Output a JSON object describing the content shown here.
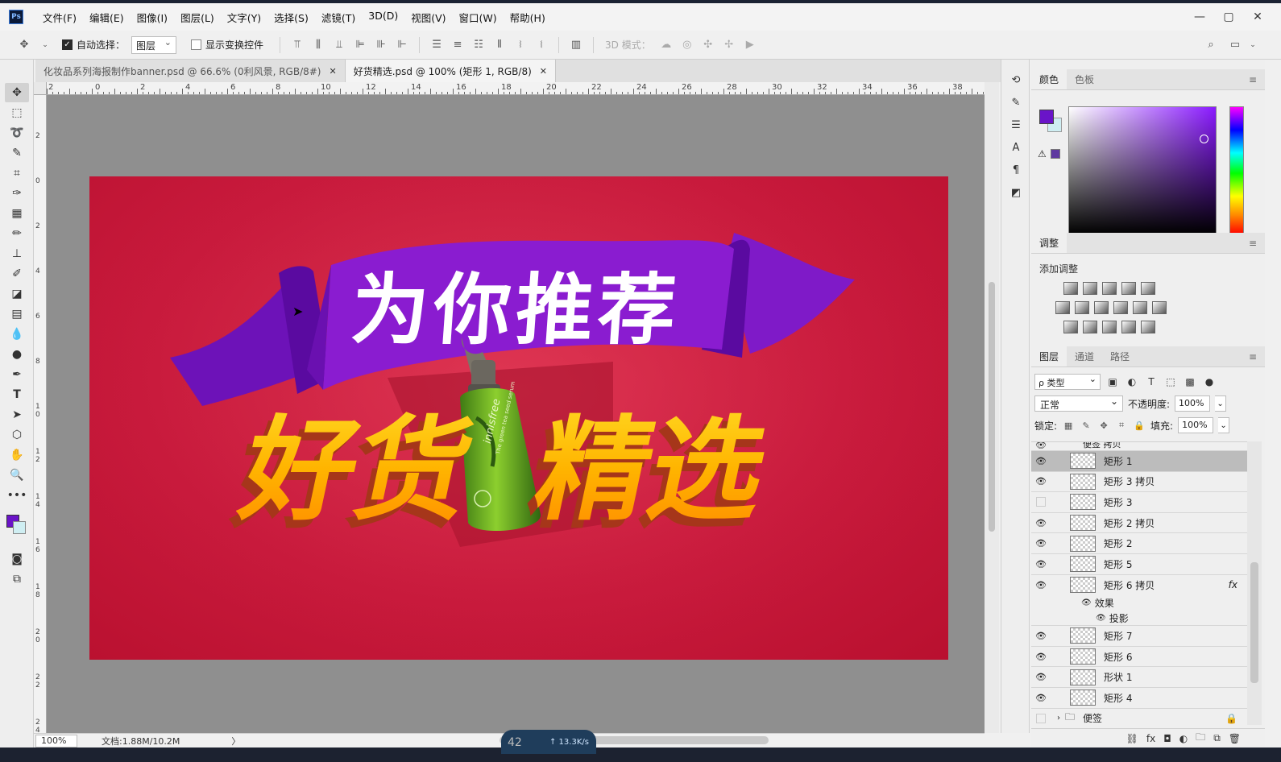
{
  "app": {
    "logo": "Ps"
  },
  "menu": [
    "文件(F)",
    "编辑(E)",
    "图像(I)",
    "图层(L)",
    "文字(Y)",
    "选择(S)",
    "滤镜(T)",
    "3D(D)",
    "视图(V)",
    "窗口(W)",
    "帮助(H)"
  ],
  "window_controls": {
    "minimize": "—",
    "restore": "▢",
    "close": "✕"
  },
  "options": {
    "auto_select_label": "自动选择：",
    "auto_select_target": "图层",
    "show_transform_label": "显示变换控件",
    "mode_3d_label": "3D 模式："
  },
  "tabs": [
    {
      "label": "化妆品系列海报制作banner.psd @ 66.6% (0利风景, RGB/8#)",
      "close": "✕"
    },
    {
      "label": "好货精选.psd @ 100% (矩形 1, RGB/8)",
      "close": "✕"
    }
  ],
  "ruler_h": [
    "2",
    "0",
    "2",
    "4",
    "6",
    "8",
    "10",
    "12",
    "14",
    "16",
    "18",
    "20",
    "22",
    "24",
    "26",
    "28",
    "30",
    "32",
    "34",
    "36",
    "38"
  ],
  "ruler_v": [
    "2",
    "0",
    "2",
    "4",
    "6",
    "8",
    "1 0",
    "1 2",
    "1 4",
    "1 6",
    "1 8",
    "2 0",
    "2 2",
    "2 4"
  ],
  "artwork": {
    "headline": "为你推荐",
    "sub_left": "好货",
    "sub_right": "精选",
    "bottle_brand": "innisfree",
    "bottle_text": "The green tea seed serum",
    "colors": {
      "background": "#c81a3c",
      "ribbon": "#7a1ac2",
      "gold": "#ffb400"
    }
  },
  "status": {
    "zoom": "100%",
    "doc_info": "文档:1.88M/10.2M",
    "arrow": "〉",
    "net_speed": "↑ 13.3K/s",
    "net_num": "42"
  },
  "color_panel": {
    "tabs": [
      "颜色",
      "色板"
    ],
    "fg": "#6a14c8",
    "bg": "#cfeef2"
  },
  "adjust_panel": {
    "tab": "调整",
    "title": "添加调整"
  },
  "layers_panel": {
    "tabs": [
      "图层",
      "通道",
      "路径"
    ],
    "kind": "ρ 类型",
    "blend": "正常",
    "opacity_label": "不透明度:",
    "opacity": "100%",
    "lock_label": "锁定:",
    "fill_label": "填充:",
    "fill": "100%",
    "group_top": "便签 拷贝",
    "layers": [
      {
        "name": "矩形 1",
        "visible": true,
        "selected": true
      },
      {
        "name": "矩形 3 拷贝",
        "visible": true
      },
      {
        "name": "矩形 3",
        "visible": false
      },
      {
        "name": "矩形 2 拷贝",
        "visible": true
      },
      {
        "name": "矩形 2",
        "visible": true
      },
      {
        "name": "矩形 5",
        "visible": true
      },
      {
        "name": "矩形 6 拷贝",
        "visible": true,
        "fx": "fx"
      },
      {
        "name": "矩形 7",
        "visible": true
      },
      {
        "name": "矩形 6",
        "visible": true
      },
      {
        "name": "形状 1",
        "visible": true
      },
      {
        "name": "矩形 4",
        "visible": true
      }
    ],
    "effects_label": "效果",
    "effect_item": "投影",
    "group_bottom": "便签"
  }
}
